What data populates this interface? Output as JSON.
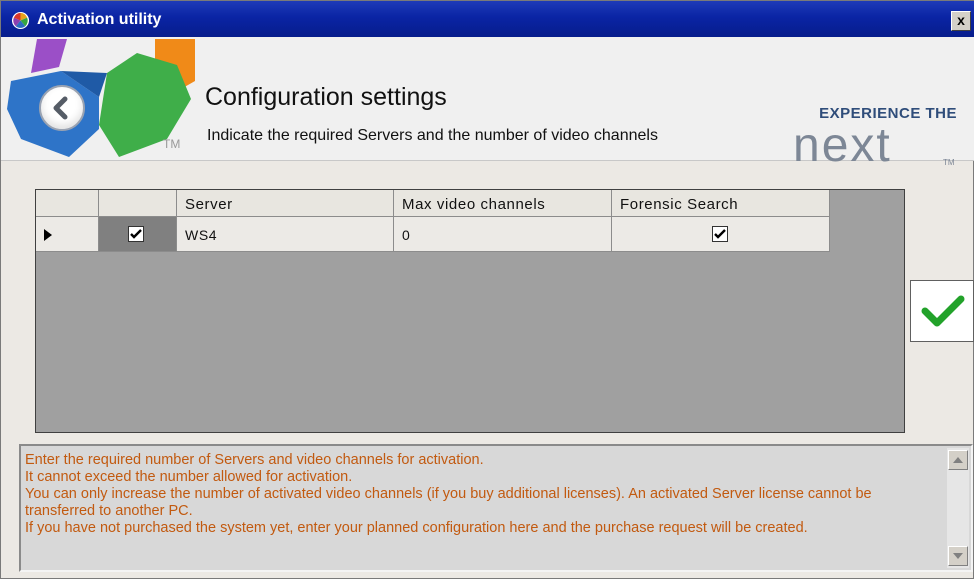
{
  "window": {
    "title": "Activation utility",
    "close_label": "x"
  },
  "header": {
    "title": "Configuration settings",
    "subtitle": "Indicate the required Servers and the number of video channels",
    "tm": "TM",
    "brand_top": "EXPERIENCE THE",
    "brand_name": "next",
    "brand_tm": "TM"
  },
  "grid": {
    "columns": [
      "",
      "",
      "Server",
      "Max video channels",
      "Forensic Search"
    ],
    "rows": [
      {
        "selected": true,
        "enabled_checked": true,
        "server": "WS4",
        "max_video_channels": "0",
        "forensic_search_checked": true
      }
    ]
  },
  "info": {
    "lines": [
      "Enter the required number of Servers and video channels for activation.",
      "It cannot exceed the number allowed for activation.",
      "You can only increase the number of activated video channels (if you buy additional licenses). An activated Server license cannot be transferred to another PC.",
      "If you have not purchased the system yet, enter your planned configuration here and the purchase request  will be created."
    ]
  },
  "colors": {
    "title_bar": "#0a24a4",
    "info_text": "#c25a10",
    "ok_check": "#22a22a"
  },
  "icons": {
    "back": "back-arrow-icon",
    "ok": "checkmark-icon",
    "app": "app-logo-icon"
  }
}
